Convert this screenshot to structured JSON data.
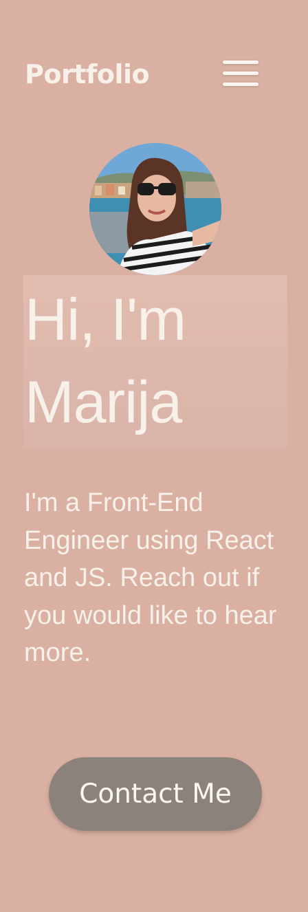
{
  "header": {
    "logo": "Portfolio",
    "menu_icon": "hamburger-menu-icon"
  },
  "profile": {
    "photo": "profile-photo"
  },
  "hero": {
    "title_line1": "Hi, I'm",
    "title_line2": "Marija",
    "intro": "I'm a Front-End Engineer using React and JS. Reach out if you would like to hear more."
  },
  "cta": {
    "contact_label": "Contact Me"
  },
  "colors": {
    "background": "#d9b0a2",
    "text": "#f7f1ea",
    "button": "#8c827c"
  }
}
